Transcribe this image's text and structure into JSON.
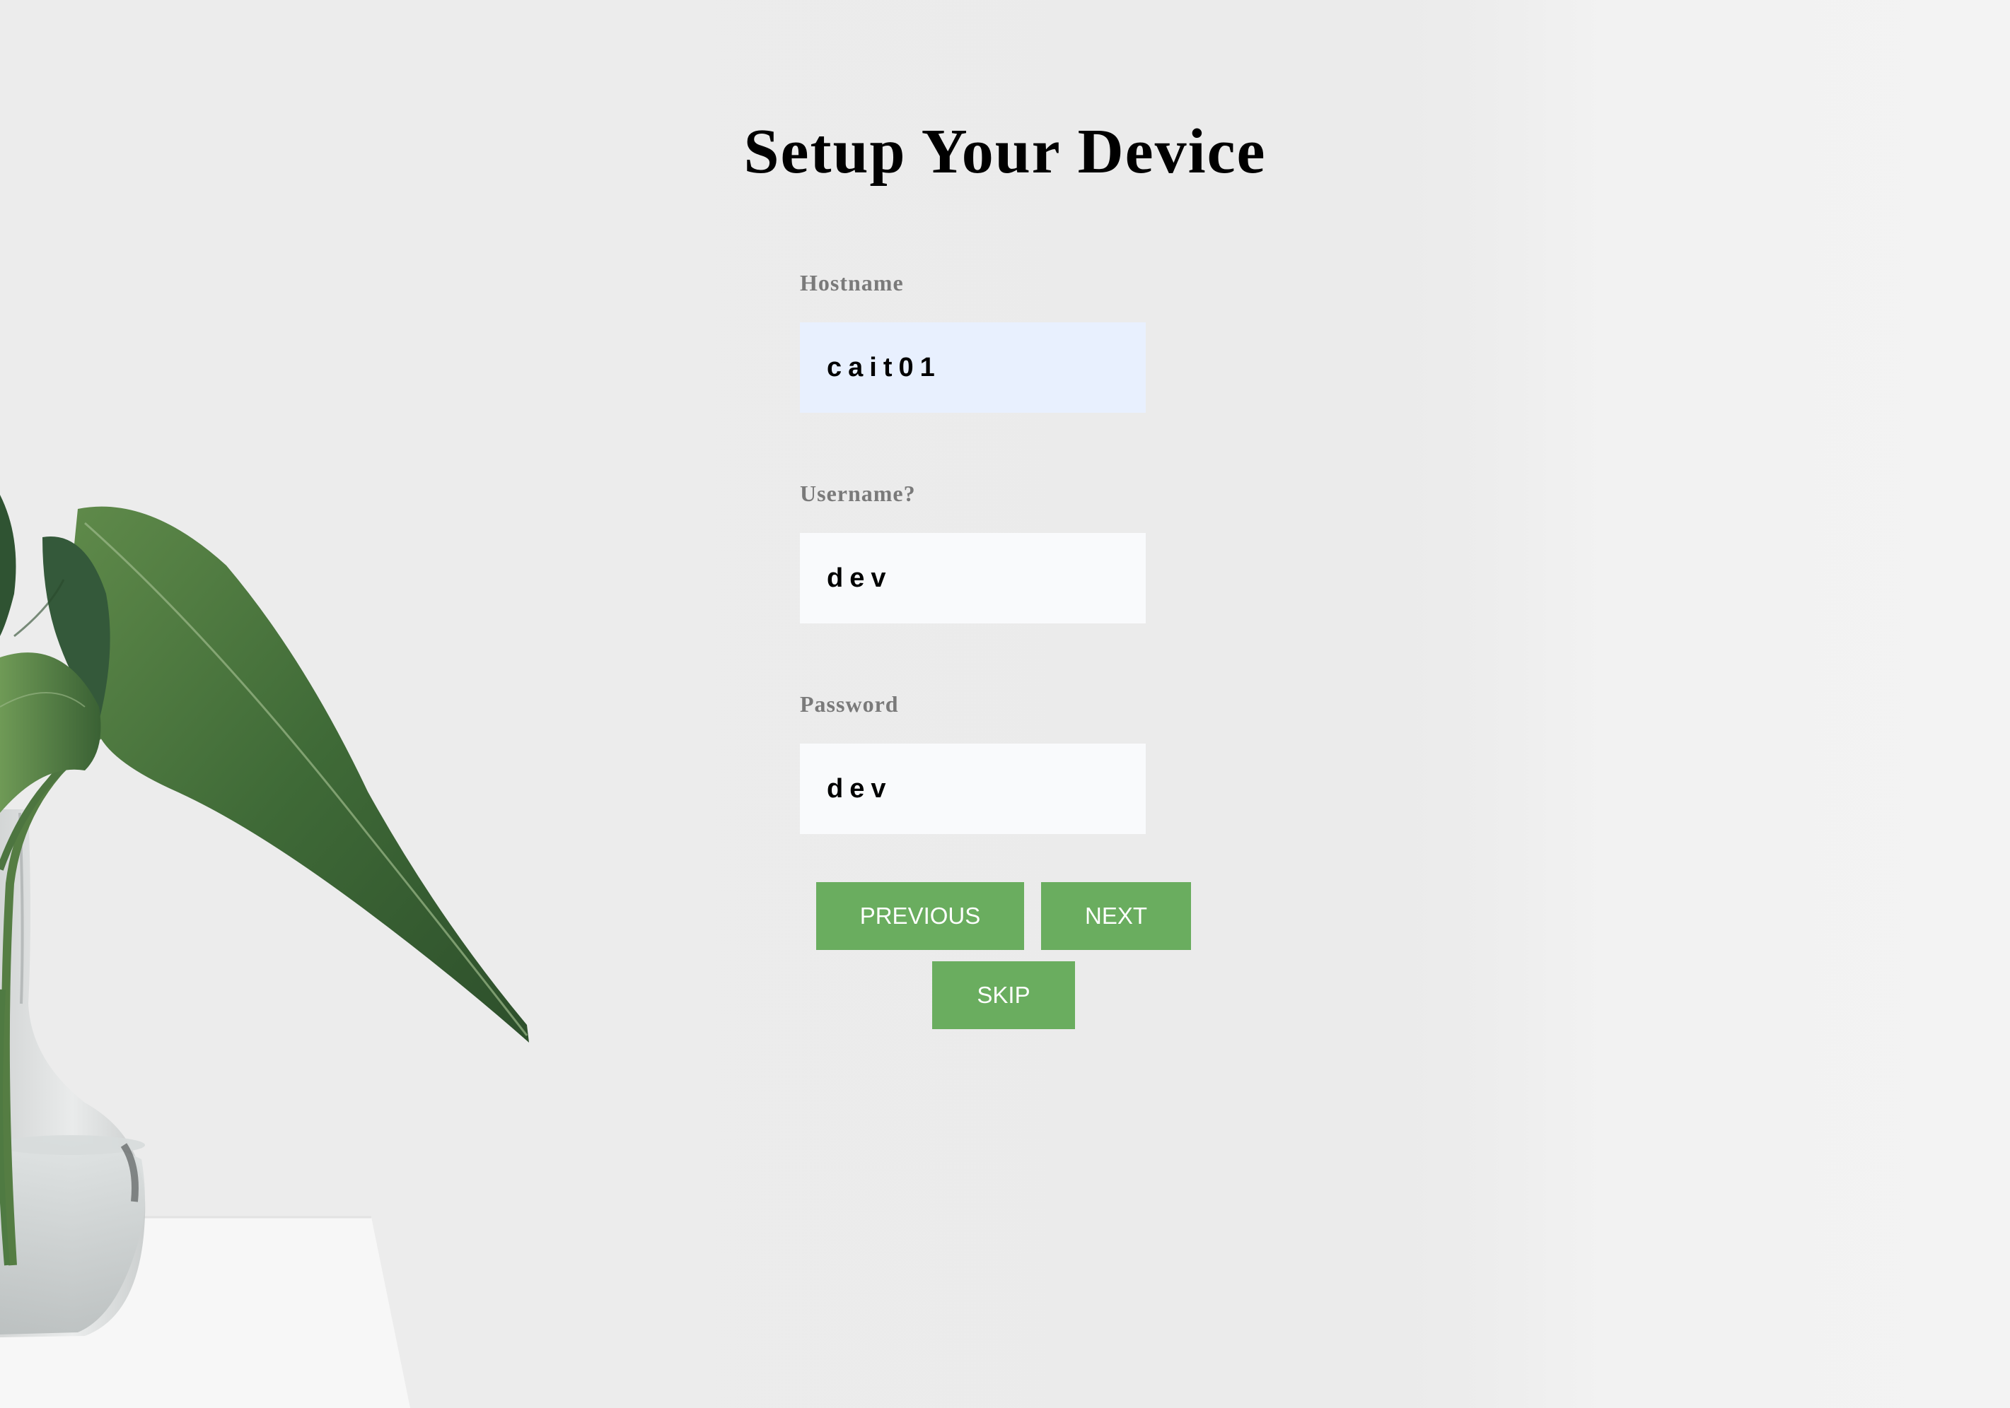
{
  "page": {
    "title": "Setup Your Device"
  },
  "form": {
    "hostname": {
      "label": "Hostname",
      "value": "cait01"
    },
    "username": {
      "label": "Username?",
      "value": "dev"
    },
    "password": {
      "label": "Password",
      "value": "dev"
    }
  },
  "buttons": {
    "previous": "PREVIOUS",
    "next": "NEXT",
    "skip": "SKIP"
  },
  "colors": {
    "button_bg": "#6aad5f",
    "button_text": "#ffffff",
    "autofill_input_bg": "#e8f0fe",
    "input_bg": "#f9fafc",
    "label_text": "#7a7a7a",
    "background": "#ececec"
  },
  "background_image": {
    "icon": "plant-in-glass-vase"
  }
}
